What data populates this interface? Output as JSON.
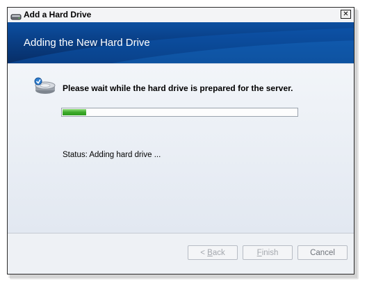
{
  "window": {
    "title": "Add a Hard Drive",
    "close_glyph": "✕"
  },
  "banner": {
    "title": "Adding the New Hard Drive"
  },
  "content": {
    "message": "Please wait while the hard drive is prepared for the server.",
    "progress_percent": 10,
    "status": "Status: Adding hard drive ..."
  },
  "footer": {
    "back_prefix": "< ",
    "back_mnemonic": "B",
    "back_rest": "ack",
    "finish_mnemonic": "F",
    "finish_rest": "inish",
    "cancel_label": "Cancel"
  },
  "colors": {
    "banner": "#0a3f86",
    "progress_fill": "#3daa2a"
  },
  "icons": [
    "hard-drive-icon",
    "close-icon",
    "drive-wizard-icon"
  ]
}
